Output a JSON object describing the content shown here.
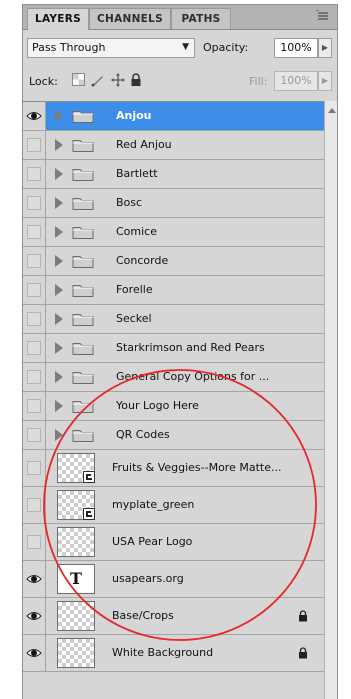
{
  "tabs": [
    "LAYERS",
    "CHANNELS",
    "PATHS"
  ],
  "blend_mode": "Pass Through",
  "opacity_label": "Opacity:",
  "opacity_value": "100%",
  "lock_label": "Lock:",
  "fill_label": "Fill:",
  "fill_value": "100%",
  "layers": [
    {
      "name": "Anjou",
      "type": "group",
      "visible": true,
      "selected": true,
      "locked": false
    },
    {
      "name": "Red Anjou",
      "type": "group",
      "visible": false,
      "selected": false,
      "locked": false
    },
    {
      "name": "Bartlett",
      "type": "group",
      "visible": false,
      "selected": false,
      "locked": false
    },
    {
      "name": "Bosc",
      "type": "group",
      "visible": false,
      "selected": false,
      "locked": false
    },
    {
      "name": "Comice",
      "type": "group",
      "visible": false,
      "selected": false,
      "locked": false
    },
    {
      "name": "Concorde",
      "type": "group",
      "visible": false,
      "selected": false,
      "locked": false
    },
    {
      "name": "Forelle",
      "type": "group",
      "visible": false,
      "selected": false,
      "locked": false
    },
    {
      "name": "Seckel",
      "type": "group",
      "visible": false,
      "selected": false,
      "locked": false
    },
    {
      "name": "Starkrimson and Red Pears",
      "type": "group",
      "visible": false,
      "selected": false,
      "locked": false
    },
    {
      "name": "General Copy Options for ...",
      "type": "group",
      "visible": false,
      "selected": false,
      "locked": false
    },
    {
      "name": "Your Logo Here",
      "type": "group",
      "visible": false,
      "selected": false,
      "locked": false
    },
    {
      "name": "QR Codes",
      "type": "group",
      "visible": false,
      "selected": false,
      "locked": false
    },
    {
      "name": "Fruits & Veggies--More Matte...",
      "type": "smart",
      "visible": false,
      "selected": false,
      "locked": false
    },
    {
      "name": "myplate_green",
      "type": "smart",
      "visible": false,
      "selected": false,
      "locked": false
    },
    {
      "name": "USA Pear Logo",
      "type": "layer",
      "visible": false,
      "selected": false,
      "locked": false
    },
    {
      "name": "usapears.org",
      "type": "text",
      "visible": true,
      "selected": false,
      "locked": false,
      "thumb_glyph": "T"
    },
    {
      "name": "Base/Crops",
      "type": "layer",
      "visible": true,
      "selected": false,
      "locked": true
    },
    {
      "name": "White Background",
      "type": "layer",
      "visible": true,
      "selected": false,
      "locked": true
    }
  ],
  "colors": {
    "panel_bg": "#d6d6d6",
    "selected_row": "#3d8ee8",
    "annotation": "#e8252b"
  }
}
